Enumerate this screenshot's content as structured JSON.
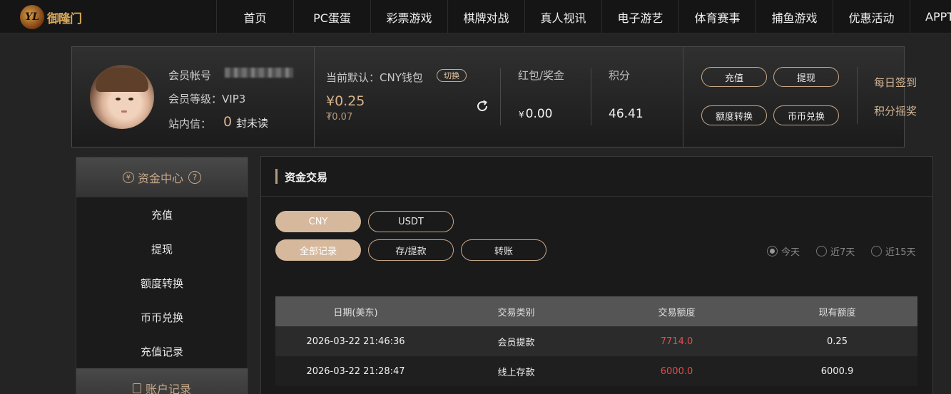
{
  "brand": {
    "logo_text": "御隆门",
    "logo_mark": "YL"
  },
  "nav": [
    {
      "label": "首页"
    },
    {
      "label": "PC蛋蛋"
    },
    {
      "label": "彩票游戏"
    },
    {
      "label": "棋牌对战"
    },
    {
      "label": "真人视讯"
    },
    {
      "label": "电子游艺"
    },
    {
      "label": "体育赛事"
    },
    {
      "label": "捕鱼游戏"
    },
    {
      "label": "优惠活动"
    },
    {
      "label": "APPT"
    }
  ],
  "member": {
    "account_label": "会员帐号",
    "level_label": "会员等级：",
    "level_value": "VIP3",
    "inbox_label": "站内信：",
    "unread_count": "0",
    "unread_suffix": "封未读"
  },
  "wallet": {
    "current_label": "当前默认：CNY钱包",
    "switch_label": "切换",
    "balance": "¥0.25",
    "balance_sub": "₮0.07",
    "bonus_label": "红包/奖金",
    "bonus_currency": "¥",
    "bonus_value": "0.00",
    "points_label": "积分",
    "points_value": "46.41"
  },
  "actions": {
    "deposit": "充值",
    "withdraw": "提现",
    "transfer": "额度转换",
    "exchange": "币币兑换",
    "daily_checkin": "每日签到",
    "points_lottery": "积分摇奖"
  },
  "sidebar": {
    "fund_center_title": "资金中心",
    "fund_center_icon": "¥",
    "help_icon": "?",
    "items": [
      {
        "label": "充值"
      },
      {
        "label": "提现"
      },
      {
        "label": "额度转换"
      },
      {
        "label": "币币兑换"
      },
      {
        "label": "充值记录"
      }
    ],
    "account_records_title": "账户记录"
  },
  "panel": {
    "title": "资金交易",
    "currency_tabs": [
      {
        "label": "CNY",
        "active": true
      },
      {
        "label": "USDT",
        "active": false
      }
    ],
    "type_tabs": [
      {
        "label": "全部记录",
        "active": true
      },
      {
        "label": "存/提款",
        "active": false
      },
      {
        "label": "转账",
        "active": false
      }
    ],
    "date_filters": [
      {
        "label": "今天",
        "selected": true
      },
      {
        "label": "近7天",
        "selected": false
      },
      {
        "label": "近15天",
        "selected": false
      }
    ],
    "table": {
      "headers": [
        "日期(美东)",
        "交易类别",
        "交易额度",
        "现有额度"
      ],
      "rows": [
        [
          "2026-03-22 21:46:36",
          "会员提款",
          "7714.0",
          "0.25"
        ],
        [
          "2026-03-22 21:28:47",
          "线上存款",
          "6000.0",
          "6000.9"
        ]
      ]
    }
  },
  "colors": {
    "accent": "#d6b89c",
    "amount": "#e64b4b",
    "background": "#242424"
  }
}
